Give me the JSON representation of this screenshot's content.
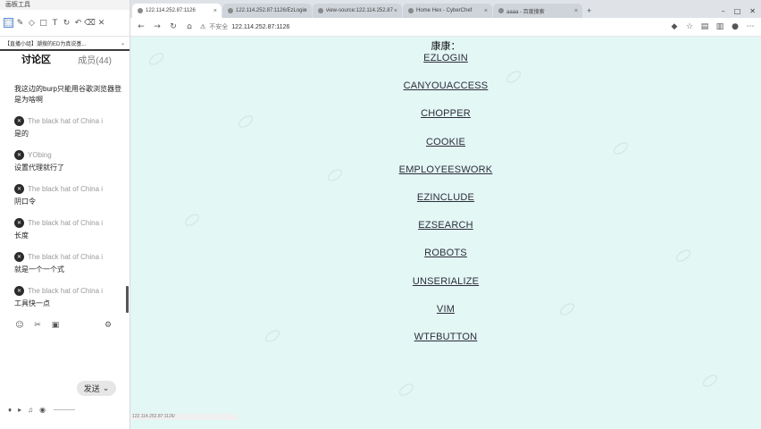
{
  "panel": {
    "title": "画板工具",
    "course_tab": "【直播小组】潮搜的ED为真说基...",
    "header_title": "讨论区",
    "header_count": "成员(44)",
    "messages": [
      {
        "kind": "text",
        "text": "我这边的burp只能用谷歌浏览器登是为啥啊"
      },
      {
        "kind": "user",
        "user": "The black hat of China i"
      },
      {
        "kind": "text",
        "text": "是的"
      },
      {
        "kind": "user",
        "user": "YObing"
      },
      {
        "kind": "text",
        "text": "设置代理就行了"
      },
      {
        "kind": "user",
        "user": "The black hat of China i"
      },
      {
        "kind": "text",
        "text": "阴口令"
      },
      {
        "kind": "user",
        "user": "The black hat of China i"
      },
      {
        "kind": "text",
        "text": "长度"
      },
      {
        "kind": "user",
        "user": "The black hat of China i"
      },
      {
        "kind": "text",
        "text": "就是一个一个式"
      },
      {
        "kind": "user",
        "user": "The black hat of China i"
      },
      {
        "kind": "text",
        "text": "工具快一点"
      }
    ],
    "send_label": "发送"
  },
  "browser": {
    "tabs": [
      {
        "label": "122.114.252.87:1126"
      },
      {
        "label": "122.114.252.87:1126/EzLogin"
      },
      {
        "label": "view-source:122.114.252.87"
      },
      {
        "label": "Home Hex - CyberChef"
      },
      {
        "label": "aaaa - 百度搜索"
      }
    ],
    "address_insecure": "不安全",
    "address_url": "122.114.252.87:1126",
    "page_title": "康康：",
    "links": [
      "EZLOGIN",
      "CANYOUACCESS",
      "CHOPPER",
      "COOKIE",
      "EMPLOYEESWORK",
      "EZINCLUDE",
      "EZSEARCH",
      "ROBOTS",
      "UNSERIALIZE",
      "VIM",
      "WTFBUTTON"
    ],
    "status_url": "122.114.252.87:1126/"
  },
  "colors": {
    "page_background": "#e3f7f5",
    "link_text": "#2d2d3a"
  }
}
